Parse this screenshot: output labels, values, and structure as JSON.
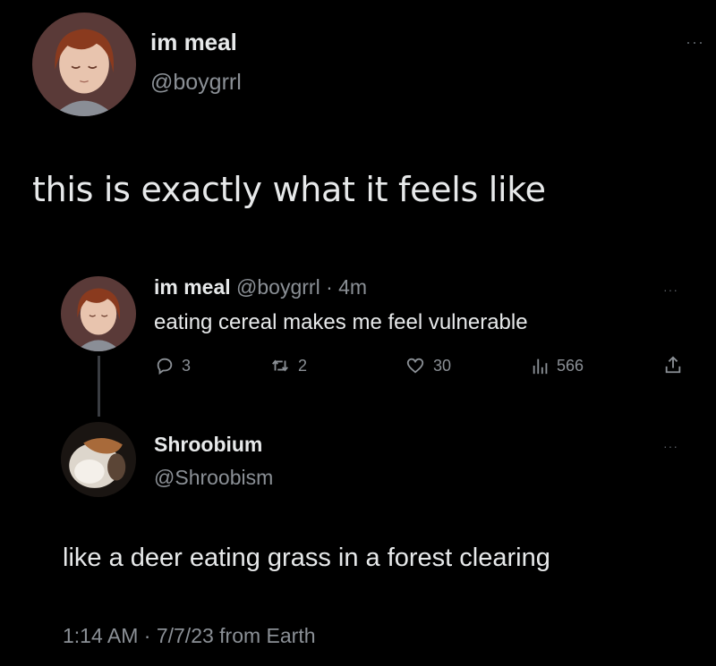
{
  "original_tweet": {
    "display_name": "im meal",
    "handle": "@boygrrl",
    "text": "this is exactly what it feels like",
    "more_glyph": "···"
  },
  "quoted_tweet": {
    "display_name": "im meal",
    "handle_time": "@boygrrl · 4m",
    "text": "eating cereal makes me feel vulnerable",
    "more_glyph": "···",
    "metrics": {
      "replies": "3",
      "retweets": "2",
      "likes": "30",
      "views": "566"
    }
  },
  "reply": {
    "display_name": "Shroobium",
    "handle": "@Shroobism",
    "text": "like a deer eating grass in a forest clearing",
    "timestamp": "1:14 AM · 7/7/23 from Earth",
    "more_glyph": "···"
  },
  "colors": {
    "background": "#000000",
    "primary_text": "#e7e9ea",
    "secondary_text": "#8b9096"
  }
}
